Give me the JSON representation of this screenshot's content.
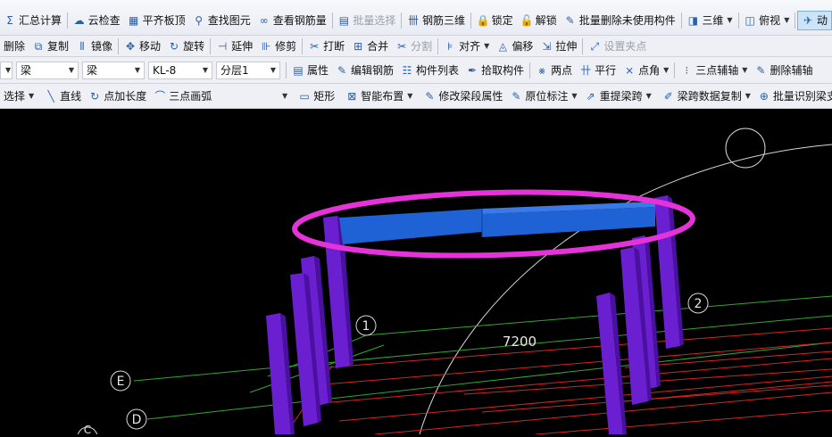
{
  "toolbar1": {
    "items": [
      {
        "icon": "sigma-icon",
        "glyph": "Σ",
        "label": "汇总计算"
      },
      {
        "icon": "cloud-check-icon",
        "glyph": "☁",
        "label": "云检查"
      },
      {
        "icon": "align-slab-icon",
        "glyph": "▦",
        "label": "平齐板顶"
      },
      {
        "icon": "binoculars-icon",
        "glyph": "⚲",
        "label": "查找图元"
      },
      {
        "icon": "glasses-icon",
        "glyph": "∞",
        "label": "查看钢筋量"
      },
      {
        "icon": "batch-select-icon",
        "glyph": "▤",
        "label": "批量选择",
        "disabled": true
      },
      {
        "icon": "rebar-3d-icon",
        "glyph": "卌",
        "label": "钢筋三维"
      },
      {
        "icon": "lock-icon",
        "glyph": "🔒",
        "label": "锁定"
      },
      {
        "icon": "unlock-icon",
        "glyph": "🔓",
        "label": "解锁"
      },
      {
        "icon": "batch-delete-icon",
        "glyph": "✎",
        "label": "批量删除未使用构件"
      },
      {
        "icon": "cube-3d-icon",
        "glyph": "◨",
        "label": "三维",
        "dropdown": true
      },
      {
        "icon": "top-view-icon",
        "glyph": "◫",
        "label": "俯视",
        "dropdown": true
      },
      {
        "icon": "dynamic-view-icon",
        "glyph": "✈",
        "label": "动",
        "active": true
      }
    ]
  },
  "toolbar2": {
    "items": [
      {
        "icon": "delete-icon",
        "glyph": "",
        "label": "删除"
      },
      {
        "icon": "copy-icon",
        "glyph": "⧉",
        "label": "复制"
      },
      {
        "icon": "mirror-icon",
        "glyph": "⫴",
        "label": "镜像"
      },
      {
        "icon": "move-icon",
        "glyph": "✥",
        "label": "移动"
      },
      {
        "icon": "rotate-icon",
        "glyph": "↻",
        "label": "旋转"
      },
      {
        "icon": "extend-icon",
        "glyph": "⊣",
        "label": "延伸"
      },
      {
        "icon": "trim-icon",
        "glyph": "⊪",
        "label": "修剪"
      },
      {
        "icon": "break-icon",
        "glyph": "✂",
        "label": "打断"
      },
      {
        "icon": "merge-icon",
        "glyph": "⊞",
        "label": "合并"
      },
      {
        "icon": "split-icon",
        "glyph": "✂",
        "label": "分割",
        "disabled": true
      },
      {
        "icon": "align-icon",
        "glyph": "⊧",
        "label": "对齐",
        "dropdown": true
      },
      {
        "icon": "offset-icon",
        "glyph": "◬",
        "label": "偏移"
      },
      {
        "icon": "stretch-icon",
        "glyph": "⇲",
        "label": "拉伸"
      },
      {
        "icon": "grip-point-icon",
        "glyph": "⤢",
        "label": "设置夹点",
        "disabled": true
      }
    ]
  },
  "toolbar3": {
    "combos": [
      {
        "value": "",
        "width": 14
      },
      {
        "value": "梁",
        "width": 70
      },
      {
        "value": "梁",
        "width": 70
      },
      {
        "value": "KL-8",
        "width": 72
      },
      {
        "value": "分层1",
        "width": 72
      }
    ],
    "items": [
      {
        "icon": "properties-icon",
        "glyph": "▤",
        "label": "属性"
      },
      {
        "icon": "edit-rebar-icon",
        "glyph": "✎",
        "label": "编辑钢筋"
      },
      {
        "icon": "component-list-icon",
        "glyph": "☷",
        "label": "构件列表"
      },
      {
        "icon": "pick-component-icon",
        "glyph": "✒",
        "label": "拾取构件"
      },
      {
        "icon": "two-point-icon",
        "glyph": "⨳",
        "label": "两点"
      },
      {
        "icon": "parallel-icon",
        "glyph": "卄",
        "label": "平行"
      },
      {
        "icon": "point-angle-icon",
        "glyph": "⨯",
        "label": "点角",
        "dropdown": true
      },
      {
        "icon": "three-point-axis-icon",
        "glyph": "⁝",
        "label": "三点辅轴",
        "dropdown": true
      },
      {
        "icon": "delete-axis-icon",
        "glyph": "✎",
        "label": "删除辅轴"
      }
    ]
  },
  "toolbar4": {
    "items": [
      {
        "icon": "select-icon",
        "glyph": "",
        "label": "选择",
        "dropdown": true
      },
      {
        "icon": "line-icon",
        "glyph": "╲",
        "label": "直线"
      },
      {
        "icon": "point-length-icon",
        "glyph": "↻",
        "label": "点加长度"
      },
      {
        "icon": "three-point-arc-icon",
        "glyph": "⌒",
        "label": "三点画弧",
        "dropdown": true,
        "wide": true
      },
      {
        "icon": "rectangle-icon",
        "glyph": "▭",
        "label": "矩形"
      },
      {
        "icon": "smart-layout-icon",
        "glyph": "⊠",
        "label": "智能布置",
        "dropdown": true
      },
      {
        "icon": "modify-beam-icon",
        "glyph": "✎",
        "label": "修改梁段属性"
      },
      {
        "icon": "in-situ-label-icon",
        "glyph": "✎",
        "label": "原位标注",
        "dropdown": true
      },
      {
        "icon": "re-extract-span-icon",
        "glyph": "⇗",
        "label": "重提梁跨",
        "dropdown": true
      },
      {
        "icon": "span-copy-icon",
        "glyph": "✐",
        "label": "梁跨数据复制",
        "dropdown": true
      },
      {
        "icon": "batch-identify-icon",
        "glyph": "⊕",
        "label": "批量识别梁支"
      }
    ]
  },
  "canvas": {
    "axis_labels": [
      "1",
      "2",
      "E",
      "D",
      "C"
    ],
    "dimension": "7200",
    "colors": {
      "column": "#6a1fd1",
      "column_dark": "#4a10a0",
      "beam": "#1f62d6",
      "beam_dark": "#0d3fa0",
      "highlight": "#e632d9",
      "grid_green": "#2fa82f",
      "grid_red": "#d42424",
      "orbit": "#d8d8d8"
    }
  }
}
